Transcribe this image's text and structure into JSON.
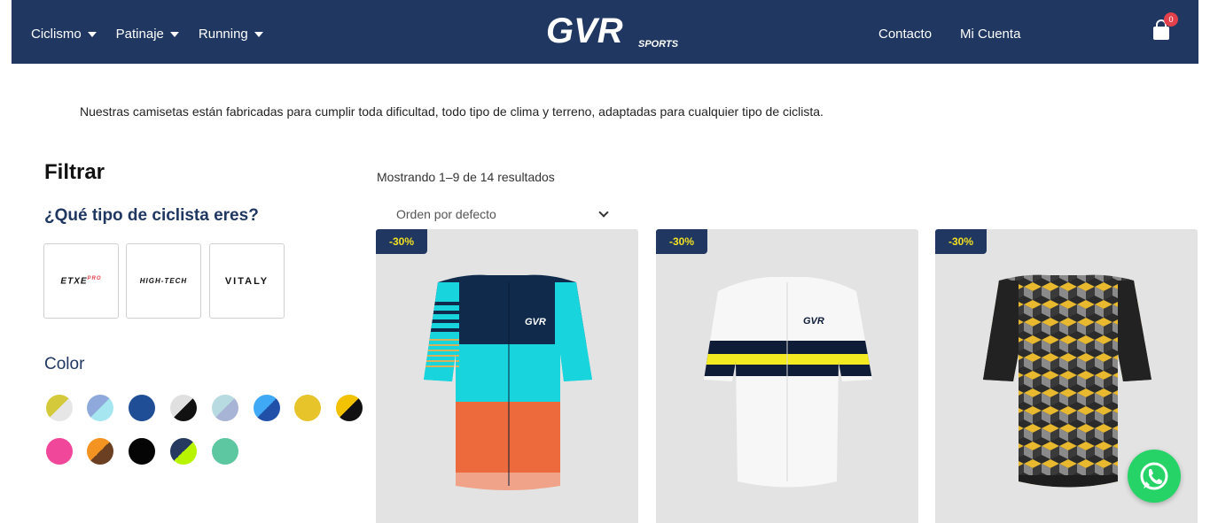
{
  "header": {
    "nav_left": [
      {
        "label": "Ciclismo"
      },
      {
        "label": "Patinaje"
      },
      {
        "label": "Running"
      }
    ],
    "logo_text": "GVR",
    "logo_sub": "SPORTS",
    "nav_right": [
      {
        "label": "Contacto"
      },
      {
        "label": "Mi Cuenta"
      }
    ],
    "cart_count": "0",
    "cart_icon": "shopping-bag-icon"
  },
  "intro_text": "Nuestras camisetas están fabricadas para cumplir toda dificultad, todo tipo de clima y terreno, adaptadas para cualquier tipo de ciclista.",
  "sidebar": {
    "title": "Filtrar",
    "cyclist_question": "¿Qué tipo de ciclista eres?",
    "brands": [
      {
        "label": "ETXE",
        "sub": "PRO"
      },
      {
        "label": "HIGH-TECH"
      },
      {
        "label": "VITALY"
      }
    ],
    "color_title": "Color",
    "colors": [
      {
        "a": "#d4c93a",
        "b": "#e6e6e6"
      },
      {
        "a": "#8fa9dc",
        "b": "#a6e6f0"
      },
      {
        "a": "#1f4e96",
        "b": "#1f4e96"
      },
      {
        "a": "#e0e0e0",
        "b": "#111111"
      },
      {
        "a": "#b7dbe0",
        "b": "#a8b4d6"
      },
      {
        "a": "#3fa9f5",
        "b": "#2150a8"
      },
      {
        "a": "#e6c42a",
        "b": "#e6c42a"
      },
      {
        "a": "#f2c100",
        "b": "#111111"
      },
      {
        "a": "#f0479b",
        "b": "#f0479b"
      },
      {
        "a": "#f39321",
        "b": "#6b3f22"
      },
      {
        "a": "#050505",
        "b": "#050505"
      },
      {
        "a": "#253a5e",
        "b": "#b8f400"
      },
      {
        "a": "#5cc7a0",
        "b": "#5cc7a0"
      }
    ]
  },
  "products": {
    "result_count": "Mostrando 1–9 de 14 resultados",
    "sort_label": "Orden por defecto",
    "items": [
      {
        "badge": "-30%",
        "jersey_logo": "GVR"
      },
      {
        "badge": "-30%",
        "jersey_logo": "GVR"
      },
      {
        "badge": "-30%"
      }
    ]
  },
  "whatsapp_icon": "whatsapp-icon"
}
